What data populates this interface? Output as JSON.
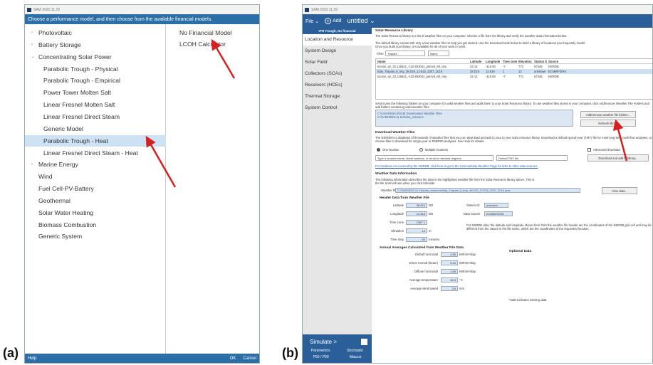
{
  "panel_a": {
    "panel_label": "(a)",
    "title": "SAM 2020.11.29",
    "prompt": "Choose a performance model, and then choose from the available financial models.",
    "models": [
      {
        "label": "Photovoltaic",
        "arrow": "›"
      },
      {
        "label": "Battery Storage",
        "arrow": "›"
      },
      {
        "label": "Concentrating Solar Power",
        "arrow": "⌄"
      },
      {
        "label": "Parabolic Trough - Physical"
      },
      {
        "label": "Parabolic Trough - Empirical"
      },
      {
        "label": "Power Tower Molten Salt"
      },
      {
        "label": "Linear Fresnel Molten Salt"
      },
      {
        "label": "Linear Fresnel Direct Steam"
      },
      {
        "label": "Generic Model"
      },
      {
        "label": "Parabolic Trough - Heat",
        "selected": true
      },
      {
        "label": "Linear Fresnel Direct Steam - Heat"
      },
      {
        "label": "Marine Energy",
        "arrow": "›"
      },
      {
        "label": "Wind"
      },
      {
        "label": "Fuel Cell-PV-Battery"
      },
      {
        "label": "Geothermal"
      },
      {
        "label": "Solar Water Heating"
      },
      {
        "label": "Biomass Combustion"
      },
      {
        "label": "Generic System"
      }
    ],
    "financial": [
      "No Financial Model",
      "LCOH Calculator"
    ],
    "footer": {
      "help": "Help",
      "ok": "OK",
      "cancel": "Cancel"
    }
  },
  "panel_b": {
    "panel_label": "(b)",
    "title": "SAM 2020.11.29",
    "menu": {
      "file": "File ⌄",
      "add": "Add",
      "case": "untitled ⌄"
    },
    "case_header": "IPH Trough, No financial",
    "nav": [
      "Location and Resource",
      "System Design",
      "Solar Field",
      "Collectors (SCAs)",
      "Receivers (HCEs)",
      "Thermal Storage",
      "System Control"
    ],
    "simulate": "Simulate >",
    "bottom_links": [
      "Parametrics",
      "Stochastic",
      "P50 / P90",
      "Macros"
    ],
    "library": {
      "heading": "Solar Resource Library",
      "desc1": "The Solar Resource library is a list of weather files on your computer. Choose a file from the library and verify the weather data information below.",
      "desc2": "The default library comes with only a few weather files to help you get started. Use the download tools below to build a library of locations you frequently model.",
      "desc3": "Once you build your library, it is available for all of your work in SAM.",
      "filter_label": "Filter:",
      "filter_value": "Trapani",
      "filter_field": "Name",
      "columns": [
        "Name",
        "Latitude",
        "Longitude",
        "Time zone",
        "Elevation",
        "Station ID",
        "Source"
      ],
      "rows": [
        [
          "tucson_az_32.116521_-110.933042_psmv3_60_tmy",
          "32.13",
          "-110.94",
          "-7",
          "773",
          "67345",
          "NSRDB"
        ],
        [
          "Italy_Trapani_it_tmy_38.019_12.515_2007_2016",
          "38.019",
          "12.515",
          "1",
          "12",
          "unknown",
          "ECMWF/ERA"
        ],
        [
          "tucson_az_32.116521_-110.933042_psmv3_60_tmy",
          "32.13",
          "-110.94",
          "-7",
          "773",
          "67345",
          "NSRDB"
        ]
      ],
      "scan_text": "SAM scans the following folders on your computer for valid weather files and adds them to your Solar Resource library. To use weather files stored in your computer, click Add/remove Weather File Folders and add folders containing valid weather files.",
      "folders": [
        "C:\\Users\\Marco\\SAM Downloaded Weather Files",
        "C:/SAM/2020.11.11/solar_resource"
      ],
      "btn_add": "Add/remove weather file folders...",
      "btn_refresh": "Refresh library"
    },
    "download": {
      "heading": "Download Weather Files",
      "desc": "The NSRDB is a database of thousands of weather files that you can download and add to your to your solar resource library. Download a default typical-year (TMY) file for most long-term cash flow analyses, or choose files to download for single-year or P50/P90 analyses. See Help for details.",
      "opt1": "One location",
      "opt2": "Multiple locations",
      "adv": "Advanced download",
      "placeholder": "Type a location name, street address, or lat,lon in decimal degrees",
      "tmy": "Default TMY file",
      "btn": "Download and add to library...",
      "link": "For locations not covered by the NSRDB, click here to go to the SAM website Weather Page for links to other data sources."
    },
    "weather": {
      "heading": "Weather Data Information",
      "desc": "The following information describes the data in the highlighted weather file from the Solar Resource library above. This is the file SAM will use when you click Simulate.",
      "file_label": "Weather file",
      "file_value": "C:\\SAM\\2020.11.11\\solar_resource\\Italy_Trapani_it_tmy_38.019_12.515_2007_2016.epw",
      "view_btn": "View data...",
      "header_title": "Header Data from Weather File",
      "fields": [
        {
          "label": "Latitude",
          "value": "38.019",
          "unit": "DD"
        },
        {
          "label": "Longitude",
          "value": "12.515",
          "unit": "DD"
        },
        {
          "label": "Time zone",
          "value": "GMT 1",
          "unit": ""
        },
        {
          "label": "Elevation",
          "value": "12",
          "unit": "m"
        },
        {
          "label": "Time step",
          "value": "60",
          "unit": "minutes"
        }
      ],
      "station_label": "Station ID",
      "station_value": "unknown",
      "source_label": "Data Source",
      "source_value": "ECMWF/ERA",
      "nsrdb_note": "For NSRDB data, the latitude and longitude shown here from the weather file header are the coordinates of the NSRDB grid cell and may be different from the values in the file name, which are the coordinates of the requested location.",
      "avg_title": "Annual Averages Calculated from Weather File  Data",
      "optional": "Optional Data",
      "averages": [
        {
          "label": "Global horizontal",
          "value": "4.86",
          "unit": "kWh/m²/day"
        },
        {
          "label": "Direct normal (beam)",
          "value": "5.43",
          "unit": "kWh/m²/day"
        },
        {
          "label": "Diffuse horizontal",
          "value": "1.68",
          "unit": "kWh/m²/day"
        },
        {
          "label": "Average temperature",
          "value": "18.3",
          "unit": "°C"
        },
        {
          "label": "Average wind speed",
          "value": "3.8",
          "unit": "m/s"
        }
      ],
      "nan_note": "*NaN indicates missing data."
    }
  }
}
